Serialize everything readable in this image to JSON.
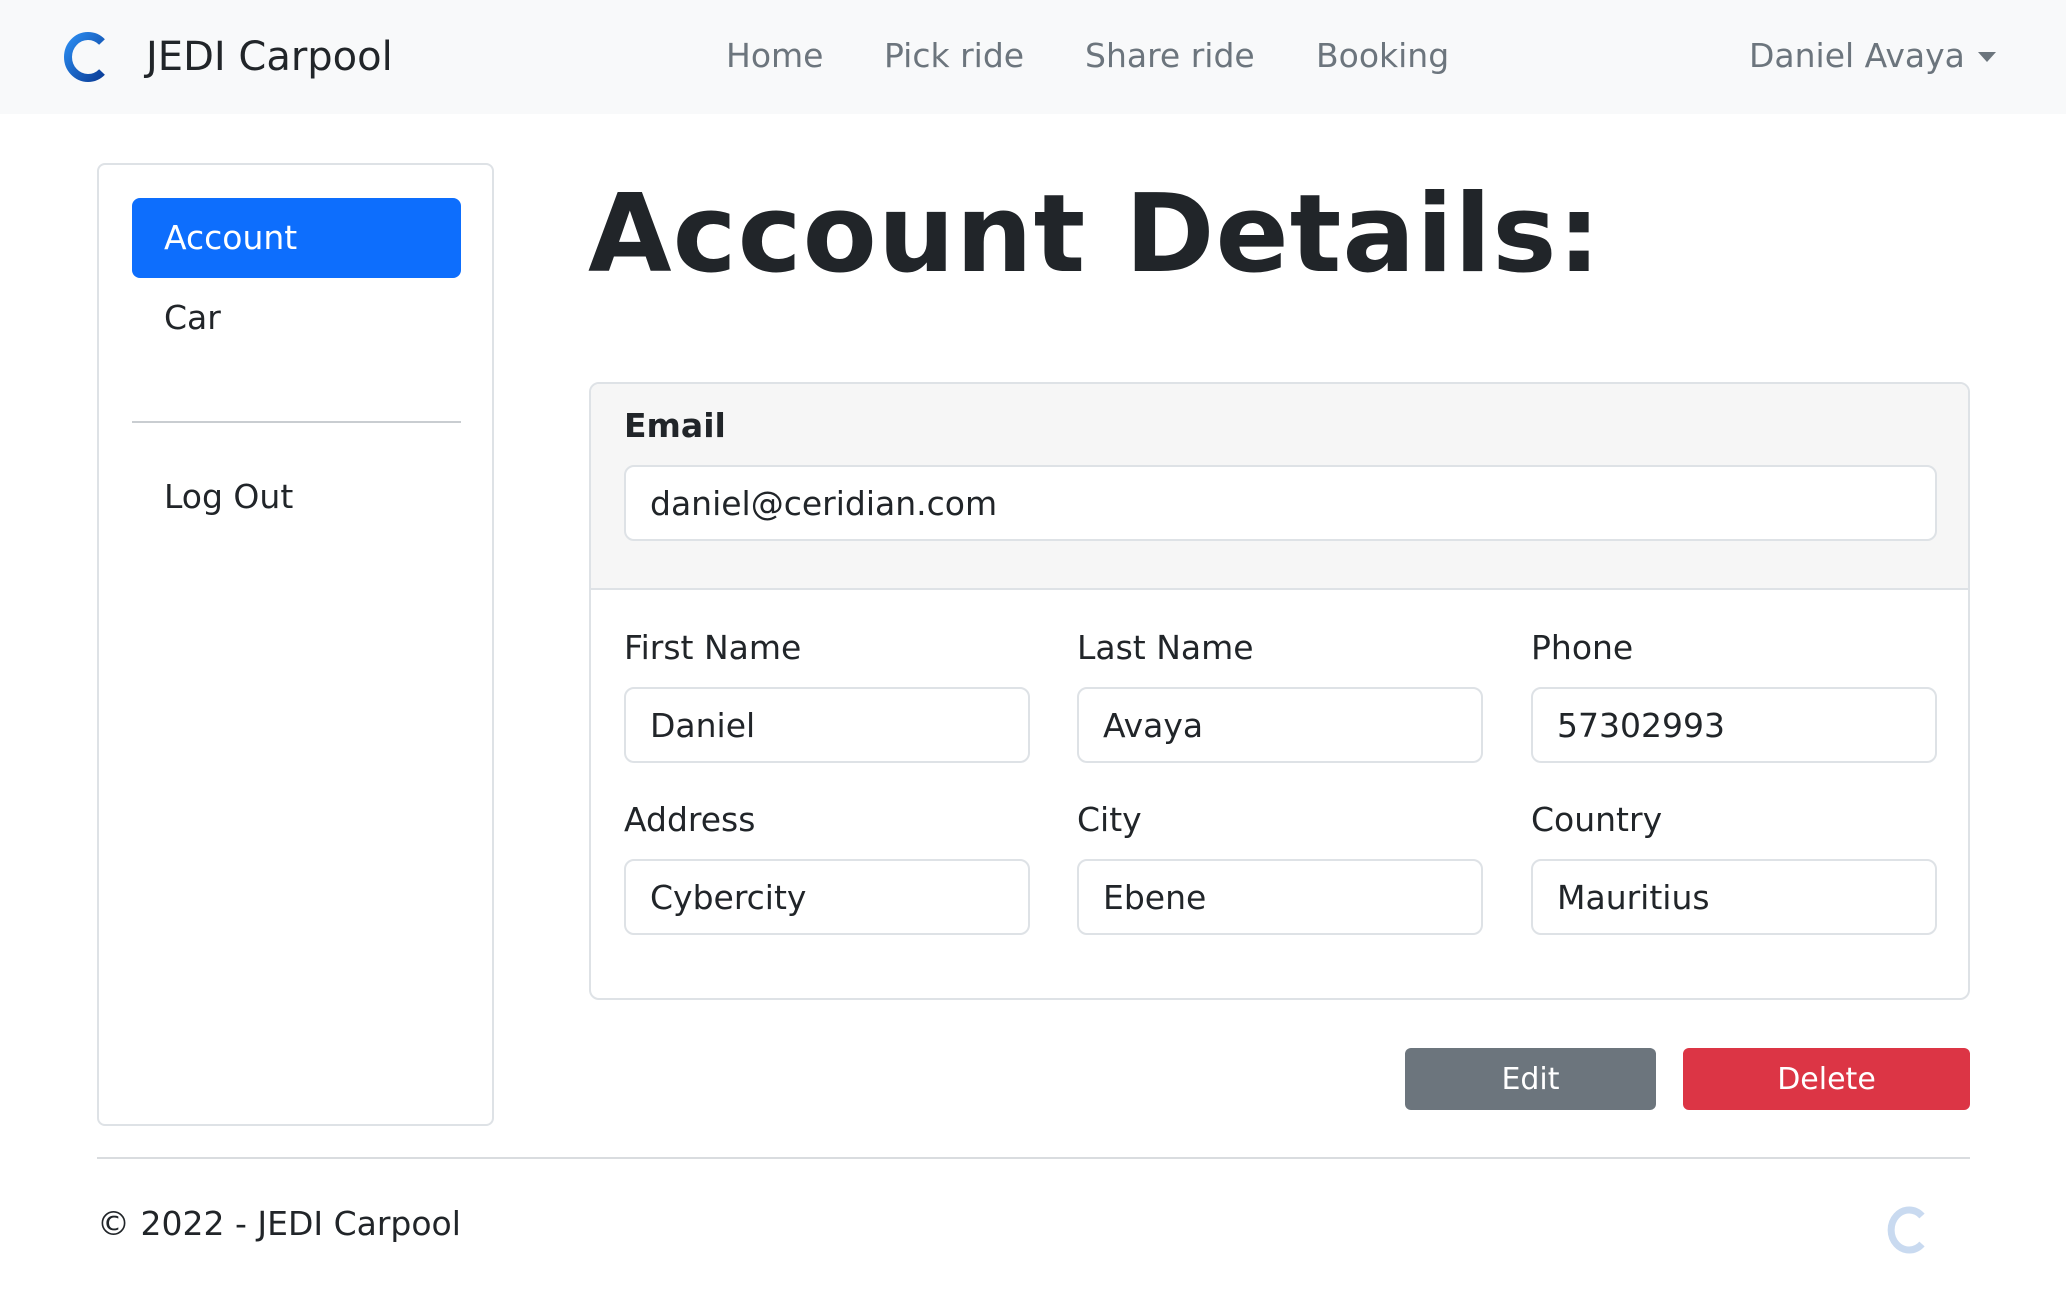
{
  "brand": {
    "name": "JEDI Carpool",
    "logo_icon": "carpool-c-logo-icon"
  },
  "nav": {
    "links": [
      "Home",
      "Pick ride",
      "Share ride",
      "Booking"
    ],
    "user": "Daniel Avaya"
  },
  "sidebar": {
    "items": [
      {
        "label": "Account",
        "active": true
      },
      {
        "label": "Car",
        "active": false
      },
      {
        "label": "Log Out",
        "active": false
      }
    ]
  },
  "main": {
    "title": "Account Details:",
    "email": {
      "label": "Email",
      "value": "daniel@ceridian.com"
    },
    "fields": [
      {
        "label": "First Name",
        "value": "Daniel"
      },
      {
        "label": "Last Name",
        "value": "Avaya"
      },
      {
        "label": "Phone",
        "value": "57302993"
      },
      {
        "label": "Address",
        "value": "Cybercity"
      },
      {
        "label": "City",
        "value": "Ebene"
      },
      {
        "label": "Country",
        "value": "Mauritius"
      }
    ],
    "buttons": {
      "edit": "Edit",
      "delete": "Delete"
    }
  },
  "footer": {
    "text": "© 2022 - JEDI Carpool"
  },
  "colors": {
    "primary": "#0d6efd",
    "secondary": "#6c757d",
    "danger": "#dc3545",
    "navbar_bg": "#f8f9fa",
    "text": "#212529"
  }
}
